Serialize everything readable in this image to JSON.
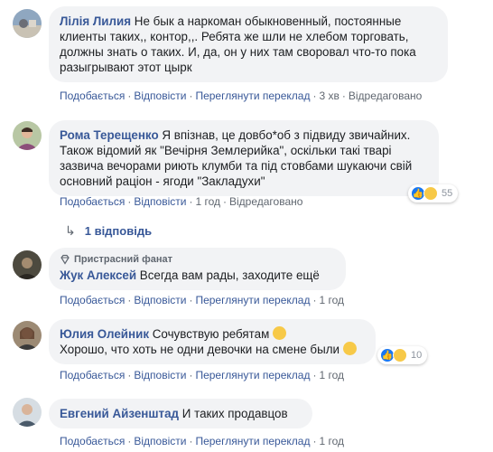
{
  "labels": {
    "like": "Подобається",
    "reply": "Відповісти",
    "see_translation": "Переглянути переклад",
    "edited": "Відредаговано"
  },
  "comments": [
    {
      "author": "Лілія Лилия",
      "text": "Не бык а наркоман обыкновенный, постоянные клиенты таких,, контор,,. Ребята же шли не хлебом торговать, должны знать о таких. И, да, он у них там своровал что-то пока разыгрывают этот цырк",
      "time": "3 хв"
    },
    {
      "author": "Рома Терещенко",
      "text": "Я впізнав, це довбо*об з підвиду звичайних. Також відомий як \"Вечірня Землерийка\", оскільки такі тварі зазвича вечорами риють клумби та під стовбами шукаючи свій основний раціон - ягоди \"Закладухи\"",
      "time": "1 год",
      "reaction_count": "55"
    },
    {
      "badge": "Пристрасний фанат",
      "author": "Жук Алексей",
      "text": "Всегда вам рады, заходите ещё",
      "time": "1 год"
    },
    {
      "author": "Юлия Олейник",
      "text_line1": "Сочувствую ребятам",
      "text_line2": "Хорошо, что хоть не одни девочки на смене были",
      "time": "1 год",
      "reaction_count": "10"
    },
    {
      "author": "Евгений Айзенштад",
      "text": "И таких продавцов",
      "time": "1 год"
    }
  ],
  "replies_link": "1 відповідь",
  "colors": {
    "link": "#385898",
    "bubble": "#f2f3f5",
    "meta": "#606770",
    "like_blue": "#1877f2",
    "haha_yellow": "#f7c948"
  }
}
